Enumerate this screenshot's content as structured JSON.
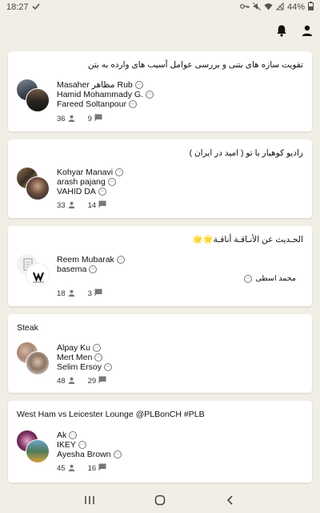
{
  "status_bar": {
    "time": "18:27",
    "battery": "44%"
  },
  "app_bar": {
    "icons": [
      "bell-icon",
      "profile-icon"
    ]
  },
  "groups": [
    {
      "title": "تقویت سازه های بتنی  و بررسی عوامل آسیب های وارده به بتن",
      "members": [
        "Masaher مظاهر Rub",
        "Hamid Mohammady G.",
        "Fareed Soltanpour"
      ],
      "member_count": "36",
      "message_count": "9"
    },
    {
      "title": "رادیو کوهیار با تو ( امید در ایران )",
      "members": [
        "Kohyar Manavi",
        "arash pajang",
        "VAHID DA"
      ],
      "member_count": "33",
      "message_count": "14"
    },
    {
      "title": "الحـديث عن الأنـاقـة أناقـة🌟🌟",
      "members": [
        "Reem Mubarak",
        "basema"
      ],
      "extra_message": "محمد اسطی",
      "member_count": "18",
      "message_count": "3"
    },
    {
      "title": "Steak",
      "members": [
        "Alpay Ku",
        "Mert Men",
        "Selim Ersoy"
      ],
      "member_count": "48",
      "message_count": "29"
    },
    {
      "title": "West Ham vs Leicester Lounge @PLBonCH #PLB",
      "members": [
        "Ak",
        "IKEY",
        "Ayesha Brown"
      ],
      "member_count": "45",
      "message_count": "16"
    }
  ],
  "nav": {
    "icons": [
      "recents-icon",
      "home-icon",
      "back-icon"
    ]
  }
}
